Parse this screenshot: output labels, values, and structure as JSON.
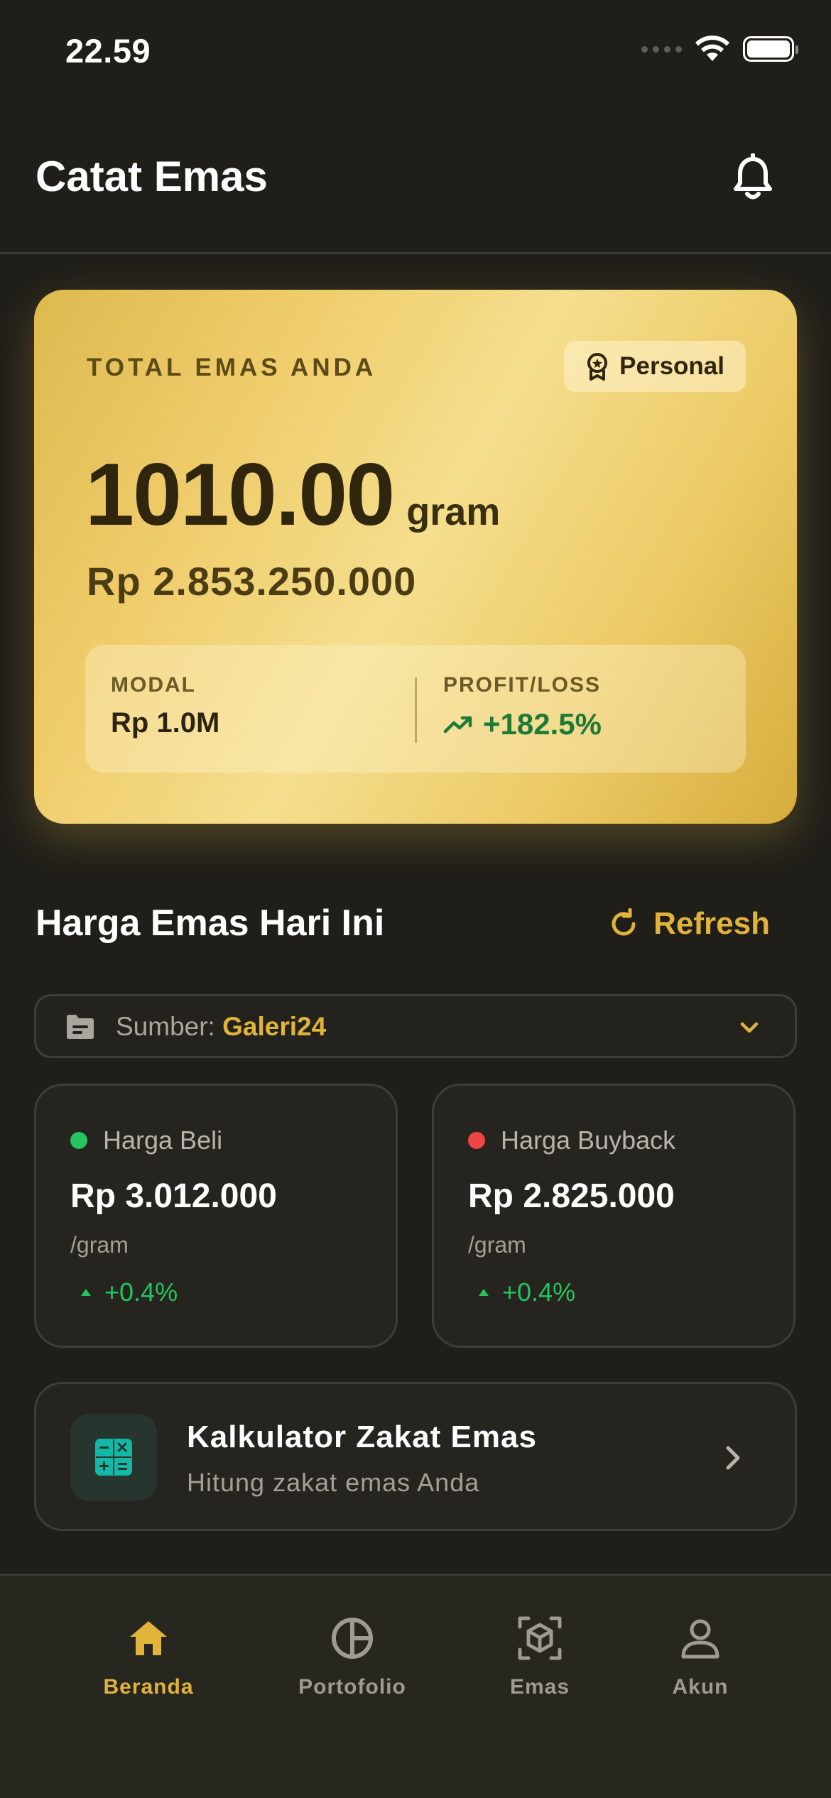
{
  "status_bar": {
    "time": "22.59"
  },
  "header": {
    "title": "Catat Emas"
  },
  "summary": {
    "label": "TOTAL EMAS ANDA",
    "badge": "Personal",
    "total_value": "1010.00",
    "total_unit": "gram",
    "total_rupiah": "Rp 2.853.250.000",
    "modal_label": "MODAL",
    "modal_value": "Rp 1.0M",
    "profit_label": "PROFIT/LOSS",
    "profit_value": "+182.5%"
  },
  "prices": {
    "section_title": "Harga Emas Hari Ini",
    "refresh_label": "Refresh",
    "source_label": "Sumber:",
    "source_value": "Galeri24",
    "buy": {
      "label": "Harga Beli",
      "value": "Rp 3.012.000",
      "unit": "/gram",
      "change": "+0.4%"
    },
    "buyback": {
      "label": "Harga Buyback",
      "value": "Rp 2.825.000",
      "unit": "/gram",
      "change": "+0.4%"
    }
  },
  "zakat": {
    "title": "Kalkulator Zakat Emas",
    "subtitle": "Hitung zakat emas Anda"
  },
  "nav": {
    "items": [
      {
        "label": "Beranda",
        "active": true
      },
      {
        "label": "Portofolio"
      },
      {
        "label": "Emas"
      },
      {
        "label": "Akun"
      }
    ]
  },
  "colors": {
    "background": "#1f1e19",
    "accent_gold": "#e0b43b",
    "positive": "#22c55e",
    "negative": "#ef4444",
    "card_surface": "#25241f"
  },
  "icons": [
    "bell-icon",
    "badge-icon",
    "trend-up-icon",
    "refresh-icon",
    "folder-icon",
    "chevron-down-icon",
    "calculator-icon",
    "chevron-right-icon",
    "home-icon",
    "pie-chart-icon",
    "cube-scan-icon",
    "user-icon"
  ]
}
